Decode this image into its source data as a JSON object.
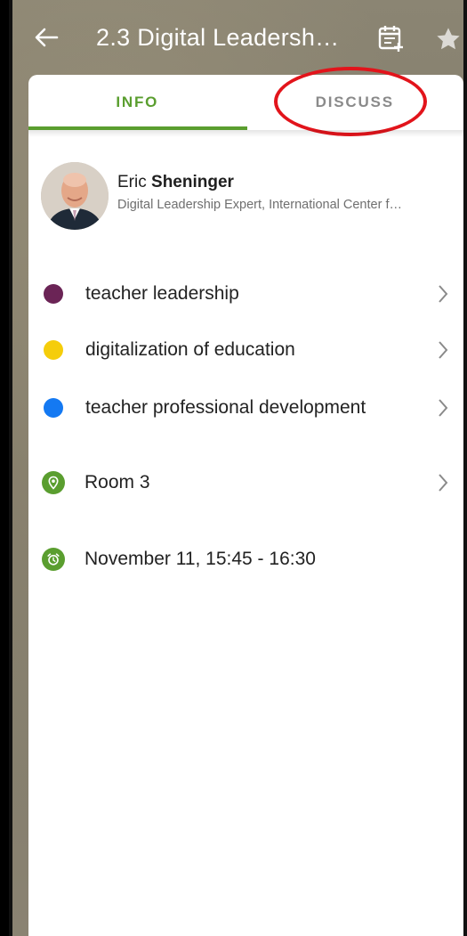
{
  "header": {
    "title": "2.3 Digital Leadersh…"
  },
  "tabs": [
    {
      "label": "INFO",
      "active": true
    },
    {
      "label": "DISCUSS",
      "active": false
    }
  ],
  "speaker": {
    "first_name": "Eric",
    "last_name": "Sheninger",
    "role": "Digital Leadership Expert, International Center f…"
  },
  "topics": [
    {
      "label": "teacher leadership",
      "color": "#6b2456"
    },
    {
      "label": "digitalization of education",
      "color": "#f5cd0b"
    },
    {
      "label": "teacher professional development",
      "color": "#1479f2"
    }
  ],
  "location": {
    "label": "Room 3"
  },
  "time": {
    "label": "November 11, 15:45 - 16:30"
  },
  "colors": {
    "accent": "#5a9e2f",
    "highlight": "#e2141b"
  }
}
